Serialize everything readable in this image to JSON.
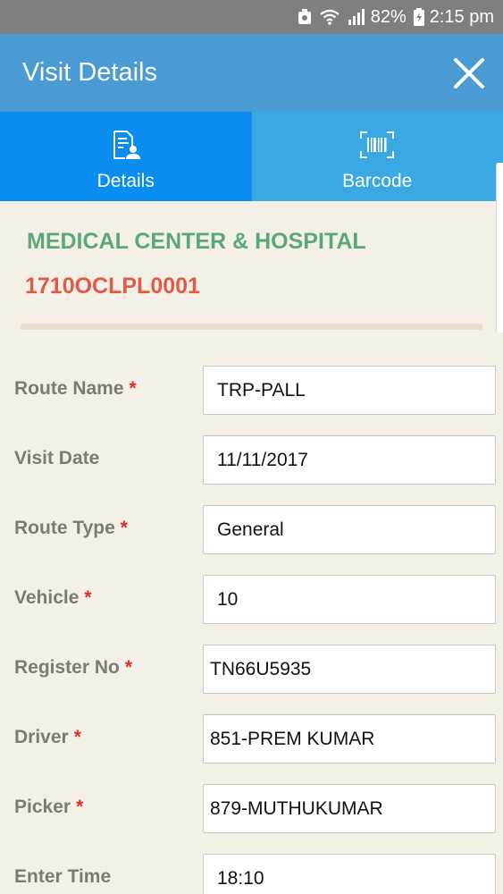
{
  "status_bar": {
    "battery_percent": "82%",
    "time": "2:15 pm"
  },
  "app_bar": {
    "title": "Visit Details",
    "close_icon": "close-icon"
  },
  "tabs": [
    {
      "label": "Details",
      "icon": "document-user-icon",
      "active": true
    },
    {
      "label": "Barcode",
      "icon": "barcode-scan-icon",
      "active": false
    }
  ],
  "header": {
    "org_name": "MEDICAL CENTER & HOSPITAL",
    "code": "1710OCLPL0001"
  },
  "form": {
    "fields": [
      {
        "label": "Route Name",
        "required": "*",
        "value": "TRP-PALL"
      },
      {
        "label": "Visit Date",
        "value": "11/11/2017"
      },
      {
        "label": "Route Type",
        "required": "*",
        "value": "General"
      },
      {
        "label": "Vehicle",
        "required": "*",
        "value": "10"
      },
      {
        "label": "Register No",
        "required": "*",
        "value": "TN66U5935"
      },
      {
        "label": "Driver",
        "required": "*",
        "value": "851-PREM KUMAR"
      },
      {
        "label": "Picker",
        "required": "*",
        "value": "879-MUTHUKUMAR"
      },
      {
        "label": "Enter Time",
        "value": "18:10"
      }
    ]
  },
  "colors": {
    "app_bar": "#4a9bd4",
    "tab_active": "#0b8df0",
    "tab_inactive": "#3aa8e2",
    "org_name": "#5aa878",
    "code": "#e05a48",
    "required": "#d9302c"
  }
}
